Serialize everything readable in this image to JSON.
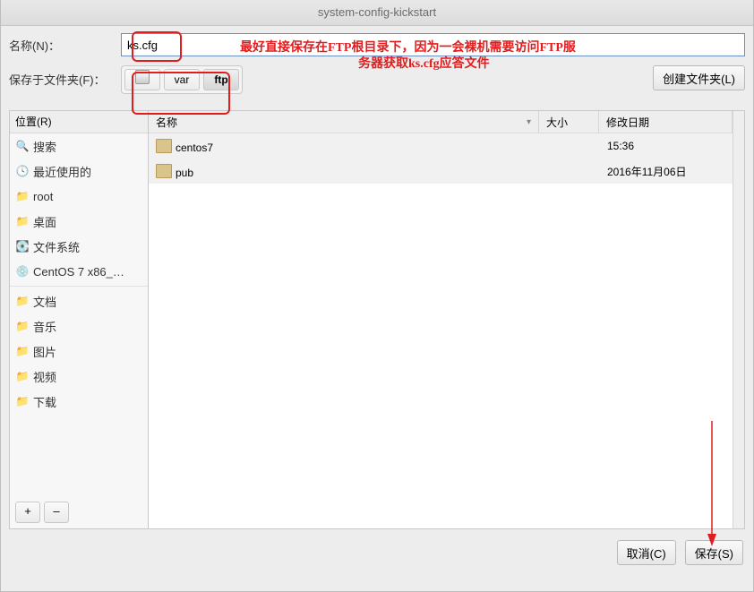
{
  "title": "system-config-kickstart",
  "labels": {
    "name": "名称(N)：",
    "save_in": "保存于文件夹(F)：",
    "create_folder": "创建文件夹(L)",
    "places_header": "位置(R)",
    "col_name": "名称",
    "col_size": "大小",
    "col_date": "修改日期",
    "cancel": "取消(C)",
    "save": "保存(S)"
  },
  "filename": "ks.cfg",
  "annotation_line1": "最好直接保存在FTP根目录下，因为一会裸机需要访问FTP服",
  "annotation_line2": "务器获取ks.cfg应答文件",
  "breadcrumb": [
    {
      "label": "",
      "icon": "disk"
    },
    {
      "label": "var"
    },
    {
      "label": "ftp",
      "active": true
    }
  ],
  "places": [
    {
      "icon": "🔍",
      "label": "搜索"
    },
    {
      "icon": "🕓",
      "label": "最近使用的"
    },
    {
      "icon": "📁",
      "label": "root"
    },
    {
      "icon": "📁",
      "label": "桌面"
    },
    {
      "icon": "💽",
      "label": "文件系统"
    },
    {
      "icon": "💿",
      "label": "CentOS 7 x86_…"
    },
    {
      "sep": true
    },
    {
      "icon": "📁",
      "label": "文档"
    },
    {
      "icon": "📁",
      "label": "音乐"
    },
    {
      "icon": "📁",
      "label": "图片"
    },
    {
      "icon": "📁",
      "label": "视频"
    },
    {
      "icon": "📁",
      "label": "下载"
    }
  ],
  "files": [
    {
      "name": "centos7",
      "size": "",
      "date": "15:36"
    },
    {
      "name": "pub",
      "size": "",
      "date": "2016年11月06日"
    }
  ],
  "mini_buttons": {
    "add": "+",
    "remove": "–"
  }
}
